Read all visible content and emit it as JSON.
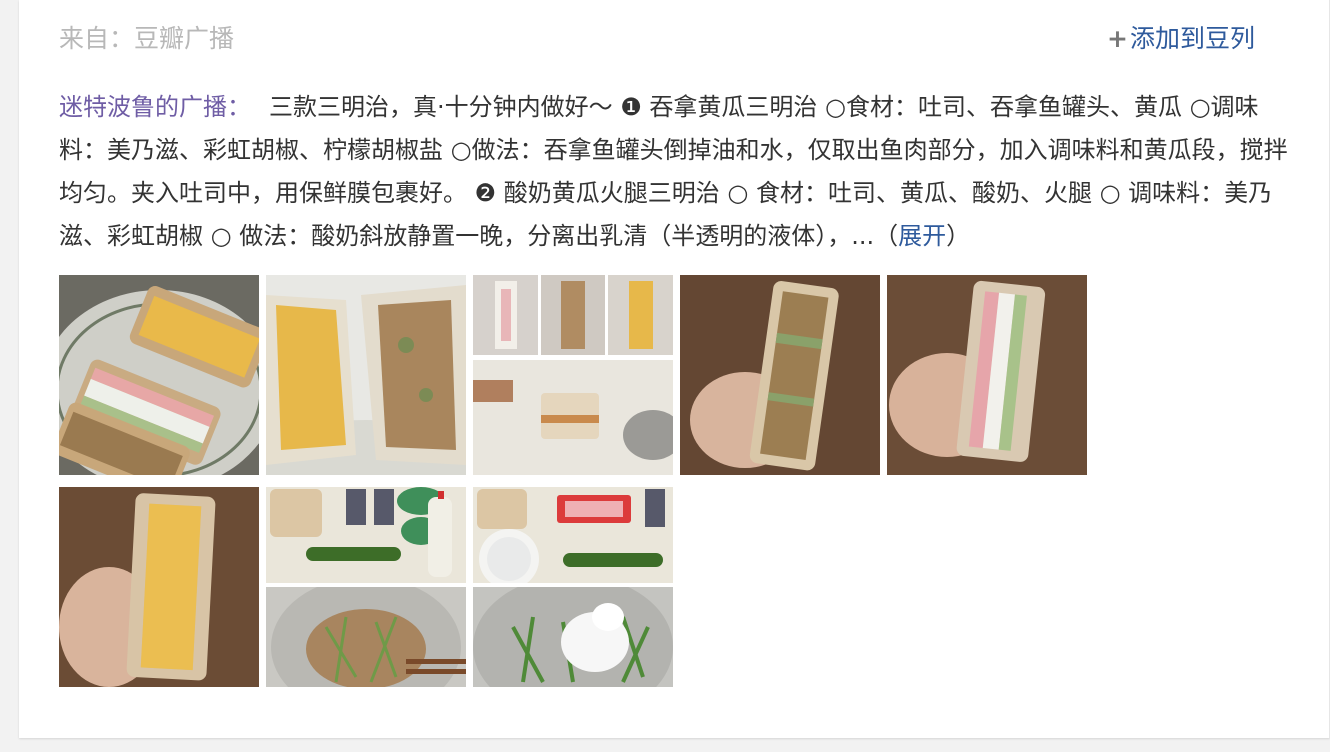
{
  "source": {
    "prefix": "来自：",
    "name": "豆瓣广播"
  },
  "add_button": {
    "icon": "plus-icon",
    "label": "添加到豆列"
  },
  "post": {
    "author": "迷特波鲁的广播：",
    "body": "三款三明治，真·十分钟内做好～ ❶ 吞拿黄瓜三明治 ○食材：吐司、吞拿鱼罐头、黄瓜 ○调味料：美乃滋、彩虹胡椒、柠檬胡椒盐 ○做法：吞拿鱼罐头倒掉油和水，仅取出鱼肉部分，加入调味料和黄瓜段，搅拌均匀。夹入吐司中，用保鲜膜包裹好。 ❷ 酸奶黄瓜火腿三明治 ○ 食材：吐司、黄瓜、酸奶、火腿 ○ 调味料：美乃滋、彩虹胡椒 ○ 做法：酸奶斜放静置一晚，分离出乳清（半透明的液体），...",
    "expand_open": "（",
    "expand_label": "展开",
    "expand_close": "）"
  },
  "images": [
    {
      "name": "photo-sandwiches-on-plate"
    },
    {
      "name": "photo-sandwich-halves-closeup"
    },
    {
      "name": "photo-collage-wrapping-steps"
    },
    {
      "name": "photo-tuna-sandwich-in-hand"
    },
    {
      "name": "photo-ham-sandwich-in-hand"
    },
    {
      "name": "photo-egg-sandwich-in-hand"
    },
    {
      "name": "photo-collage-ingredients"
    },
    {
      "name": "photo-collage-mixing"
    }
  ]
}
